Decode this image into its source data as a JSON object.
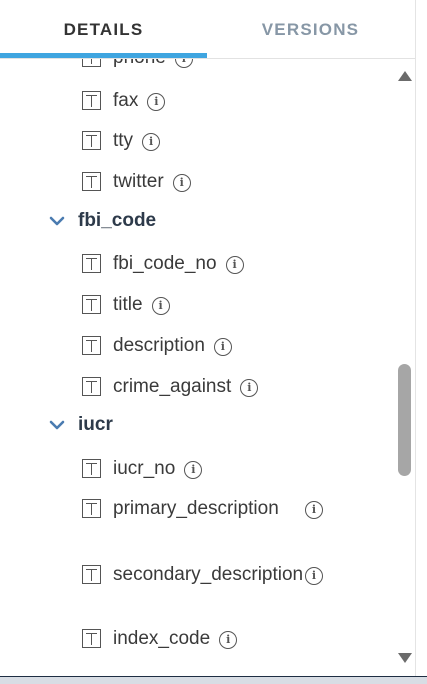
{
  "tabs": {
    "details": "DETAILS",
    "versions": "VERSIONS"
  },
  "fields_top": [
    "phone",
    "fax",
    "tty",
    "twitter"
  ],
  "groups": {
    "fbi_code": {
      "label": "fbi_code",
      "fields": [
        "fbi_code_no",
        "title",
        "description",
        "crime_against"
      ]
    },
    "iucr": {
      "label": "iucr",
      "fields": [
        "iucr_no",
        "primary_description",
        "secondary_description",
        "index_code"
      ]
    }
  },
  "info_glyph": "i",
  "colors": {
    "accent": "#3fa5e0",
    "inactive_tab": "#8797a6",
    "chevron": "#4a7bb0"
  }
}
